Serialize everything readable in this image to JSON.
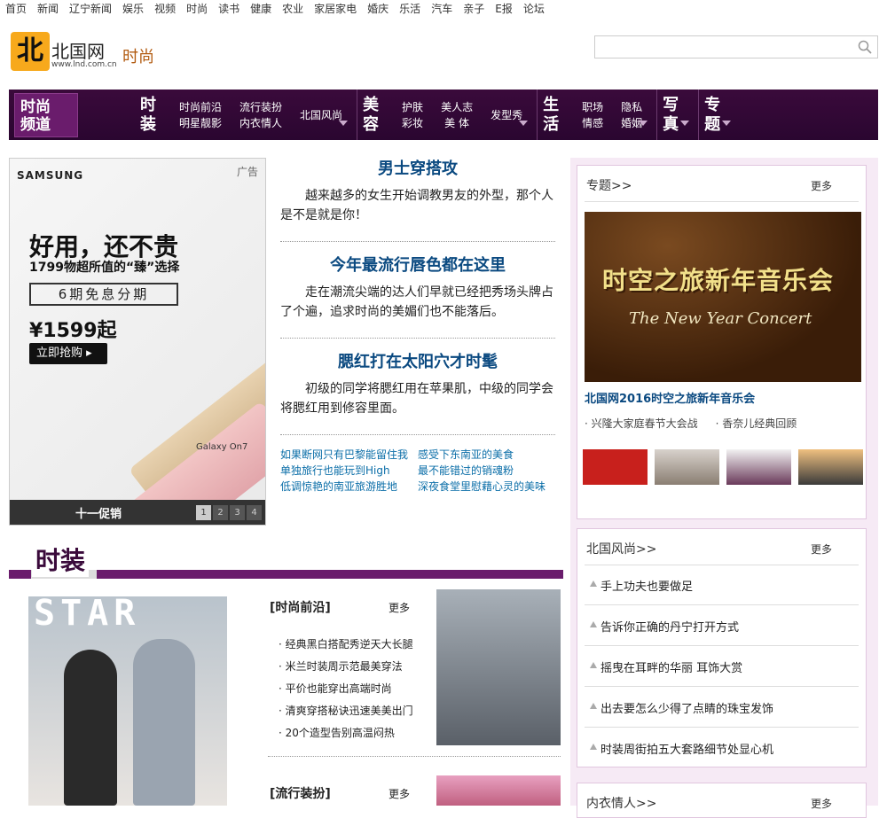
{
  "topnav": [
    "首页",
    "新闻",
    "辽宁新闻",
    "娱乐",
    "视频",
    "时尚",
    "读书",
    "健康",
    "农业",
    "家居家电",
    "婚庆",
    "乐活",
    "汽车",
    "亲子",
    "E报",
    "论坛"
  ],
  "header": {
    "site_name": "北国网",
    "site_url": "www.lnd.com.cn",
    "channel": "时尚",
    "search_placeholder": ""
  },
  "channav": {
    "home_line1": "时尚",
    "home_line2": "频道",
    "groups": [
      {
        "big": "时装",
        "cols": [
          [
            "时尚前沿",
            "明星靓影"
          ],
          [
            "流行装扮",
            "内衣情人"
          ],
          [
            "北国风尚",
            ""
          ]
        ]
      },
      {
        "big": "美容",
        "cols": [
          [
            "护肤",
            "彩妆"
          ],
          [
            "美人志",
            "美 体"
          ],
          [
            "发型秀",
            ""
          ]
        ]
      },
      {
        "big": "生活",
        "cols": [
          [
            "职场",
            "情感"
          ],
          [
            "隐私",
            "婚姻"
          ]
        ]
      },
      {
        "big": "写真",
        "cols": []
      },
      {
        "big": "专题",
        "cols": []
      }
    ]
  },
  "ad": {
    "brand": "SAMSUNG",
    "tag": "广告",
    "headline": "好用，还不贵",
    "sub": "1799物超所值的“臻”选择",
    "box": "6期免息分期",
    "price": "¥1599起",
    "button": "立即抢购 ▸",
    "model": "Galaxy On7",
    "bar_text": "十一促销",
    "pages": [
      "1",
      "2",
      "3",
      "4"
    ]
  },
  "articles": [
    {
      "title": "男士穿搭攻",
      "summary": "越来越多的女生开始调教男友的外型，那个人是不是就是你！"
    },
    {
      "title": "今年最流行唇色都在这里",
      "summary": "走在潮流尖端的达人们早就已经把秀场头牌占了个遍，追求时尚的美媚们也不能落后。"
    },
    {
      "title": "腮红打在太阳穴才时髦",
      "summary": "初级的同学将腮红用在苹果肌，中级的同学会将腮红用到修容里面。"
    }
  ],
  "links": [
    "如果断网只有巴黎能留住我",
    "感受下东南亚的美食",
    "单独旅行也能玩到High",
    "最不能错过的销魂粉",
    "低调惊艳的南亚旅游胜地",
    "深夜食堂里慰藉心灵的美味"
  ],
  "rcol": {
    "topic_head": "专题>>",
    "topic_more": "更多",
    "concert_title": "时空之旅新年音乐会",
    "concert_sub": "The New Year Concert",
    "concert_caption": "北国网2016时空之旅新年音乐会",
    "mini_links": [
      "· 兴隆大家庭春节大会战",
      "· 香奈儿经典回顾"
    ],
    "fashion_head": "北国风尚>>",
    "fashion_more": "更多",
    "fashion_items": [
      "手上功夫也要做足",
      "告诉你正确的丹宁打开方式",
      "摇曳在耳畔的华丽 耳饰大赏",
      "出去要怎么少得了点睛的珠宝发饰",
      "时装周街拍五大套路细节处显心机"
    ],
    "lingerie_head": "内衣情人>>",
    "lingerie_more": "更多"
  },
  "fashion_section": {
    "title": "时装",
    "mag_title": "STAR",
    "frontier_head": "[时尚前沿]",
    "frontier_more": "更多",
    "frontier_items": [
      "· 经典黑白搭配秀逆天大长腿",
      "· 米兰时装周示范最美穿法",
      "· 平价也能穿出高端时尚",
      "· 清爽穿搭秘诀迅速美美出门",
      "· 20个造型告别高温闷热"
    ],
    "trend_head": "[流行装扮]",
    "trend_more": "更多"
  }
}
